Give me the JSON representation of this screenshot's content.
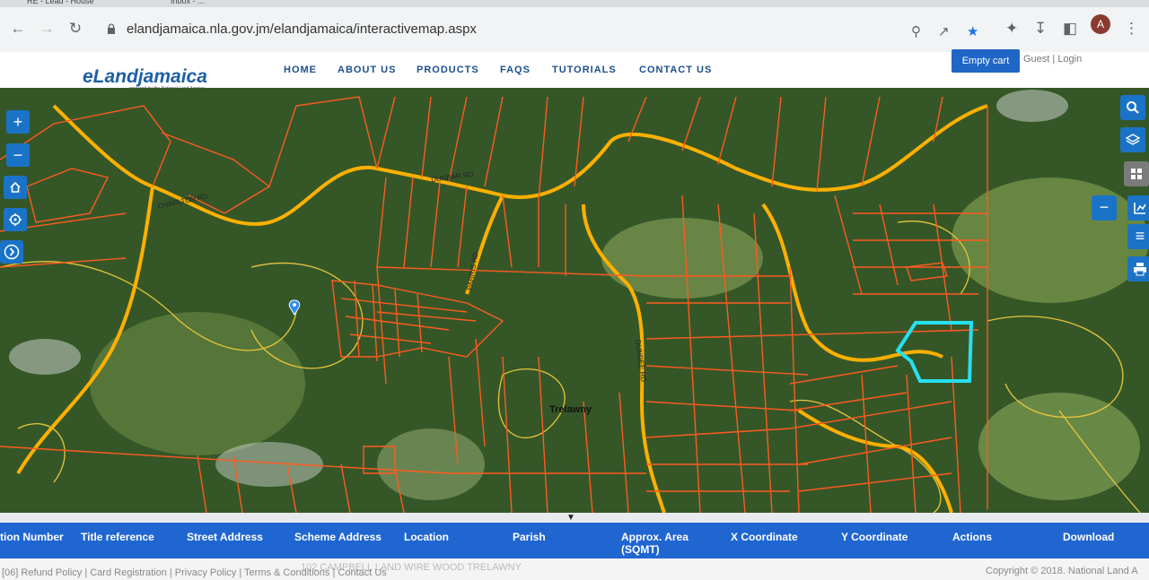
{
  "browser": {
    "tabs": [
      "RE - Lead - House",
      "Inbox - ..."
    ],
    "url": "elandjamaica.nla.gov.jm/elandjamaica/interactivemap.aspx",
    "avatar_letter": "A"
  },
  "site": {
    "logo": "eLandjamaica",
    "logo_tagline": "powered by the National Land Agency",
    "nav": [
      "HOME",
      "ABOUT US",
      "PRODUCTS",
      "FAQS",
      "TUTORIALS",
      "CONTACT US"
    ],
    "cart_label": "Empty cart",
    "login_text": "Guest | Login"
  },
  "map": {
    "parish_label": "Trelawny",
    "road_labels": [
      "DUNBAR RD",
      "CHARLTON RD",
      "PARRIS RD",
      "DUNDEE RD"
    ],
    "colors": {
      "parcel": "#ff5a1f",
      "road": "#ffb000",
      "contour": "#e8c63a",
      "selected": "#27e0f0",
      "button": "#1a73c7"
    },
    "left_controls": [
      "zoom-in-icon",
      "zoom-out-icon",
      "home-icon",
      "locate-icon",
      "arrow-right-icon"
    ],
    "right_controls": [
      "search-icon",
      "layers-icon",
      "grid-icon",
      "minus-icon",
      "measure-icon",
      "list-icon",
      "print-icon"
    ]
  },
  "table": {
    "headers": [
      "tion Number",
      "Title reference",
      "Street Address",
      "Scheme Address",
      "Location",
      "Parish",
      "Approx. Area (SQMT)",
      "X Coordinate",
      "Y Coordinate",
      "Actions",
      "Download"
    ]
  },
  "footer": {
    "links": "[06] Refund Policy | Card Registration | Privacy Policy | Terms & Conditions | Contact Us",
    "copyright": "Copyright © 2018. National Land A",
    "ghost_text": "102 CAMPBELL LAND     WIRE WOOD      TRELAWNY"
  }
}
